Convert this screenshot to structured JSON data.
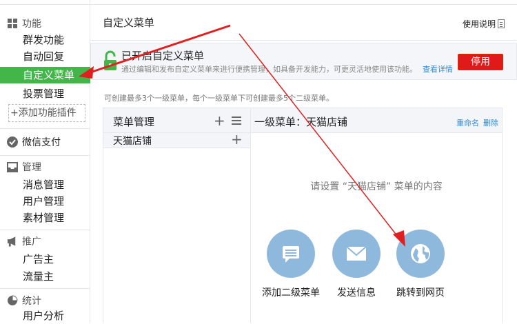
{
  "sidebar": {
    "function_header": "功能",
    "function_items": [
      "群发功能",
      "自动回复",
      "自定义菜单",
      "投票管理"
    ],
    "add_plugin": "+添加功能插件",
    "wechat_pay": "微信支付",
    "manage_header": "管理",
    "manage_items": [
      "消息管理",
      "用户管理",
      "素材管理"
    ],
    "promote_header": "推广",
    "promote_items": [
      "广告主",
      "流量主"
    ],
    "stats_header": "统计",
    "stats_items": [
      "用户分析"
    ]
  },
  "header": {
    "title": "自定义菜单",
    "help": "使用说明"
  },
  "notice": {
    "title": "已开启自定义菜单",
    "desc": "通过编辑和发布自定义菜单来进行便携管理，如具备开发能力，可更灵活地使用该功能。",
    "link": "查看详情",
    "button": "停用"
  },
  "hint": "可创建最多3个一级菜单，每个一级菜单下可创建最多5个二级菜单。",
  "menu_panel": {
    "title": "菜单管理",
    "items": [
      "天猫店铺"
    ]
  },
  "detail_panel": {
    "title": "一级菜单：天猫店铺",
    "rename": "重命名",
    "delete": "删除",
    "prompt": "请设置 “天猫店铺” 菜单的内容",
    "actions": [
      "添加二级菜单",
      "发送信息",
      "跳转到网页"
    ]
  },
  "colors": {
    "active_green": "#44b549",
    "stop_red": "#e0191b",
    "link_blue": "#2d8bd7",
    "icon_blue": "#8eb8dc",
    "annotation_red": "#e02020"
  }
}
